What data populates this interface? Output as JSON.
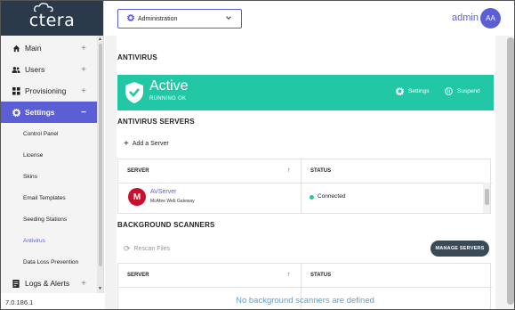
{
  "app": {
    "logo_text": "ctera",
    "version": "7.0.186.1"
  },
  "sidebar": {
    "items": [
      {
        "label": "Main",
        "icon": "home-icon"
      },
      {
        "label": "Users",
        "icon": "users-icon"
      },
      {
        "label": "Provisioning",
        "icon": "grid-icon"
      },
      {
        "label": "Settings",
        "icon": "gear-icon",
        "active": true
      },
      {
        "label": "Logs & Alerts",
        "icon": "log-icon"
      }
    ],
    "sub_items": [
      {
        "label": "Control Panel"
      },
      {
        "label": "License"
      },
      {
        "label": "Skins"
      },
      {
        "label": "Email Templates"
      },
      {
        "label": "Seeding Stations"
      },
      {
        "label": "Antivirus",
        "current": true
      },
      {
        "label": "Data Loss Prevention"
      }
    ],
    "expand_symbol": "+",
    "collapse_symbol": "−"
  },
  "header": {
    "context_select": "Administration",
    "user_name": "admin",
    "avatar_initials": "AA"
  },
  "antivirus": {
    "title": "ANTIVIRUS",
    "status": "Active",
    "status_sub": "RUNNING OK",
    "settings_label": "Settings",
    "suspend_label": "Suspend",
    "banner_color": "#22c7a6"
  },
  "servers": {
    "title": "ANTIVIRUS SERVERS",
    "add_label": "Add a Server",
    "columns": [
      "SERVER",
      "STATUS"
    ],
    "rows": [
      {
        "name": "AVServer",
        "vendor": "McAfee Web Gateway",
        "logo_letter": "M",
        "status": "Connected",
        "status_color": "#22c7a6"
      }
    ]
  },
  "scanners": {
    "title": "BACKGROUND SCANNERS",
    "rescan_label": "Rescan Files",
    "manage_label": "MANAGE SERVERS",
    "columns": [
      "SERVER",
      "STATUS"
    ],
    "empty_message": "No background scanners are defined"
  },
  "colors": {
    "accent": "#5b5fd6",
    "sidebar_dark": "#2b3a4a",
    "button_dark": "#3b4a57"
  }
}
